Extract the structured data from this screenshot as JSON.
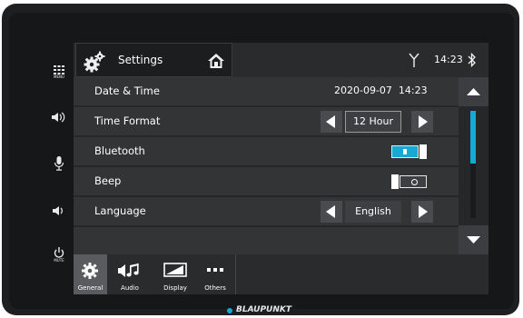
{
  "left_panel": {
    "menu_label": "MENU",
    "mute_label": "MUTE"
  },
  "header": {
    "title": "Settings",
    "clock": "14:23"
  },
  "settings_rows": [
    {
      "label": "Date & Time",
      "value": "2020-09-07  14:23"
    },
    {
      "label": "Time Format",
      "value": "12 Hour"
    },
    {
      "label": "Bluetooth",
      "state": "on"
    },
    {
      "label": "Beep",
      "state": "off"
    },
    {
      "label": "Language",
      "value": "English"
    }
  ],
  "scroll_position": 0,
  "tabs": [
    {
      "label": "General",
      "selected": true
    },
    {
      "label": "Audio"
    },
    {
      "label": "Display"
    },
    {
      "label": "Others"
    }
  ],
  "brand": "BLAUPUNKT",
  "colors": {
    "accent": "#17a8d6"
  },
  "icons": [
    "menu-grid-icon",
    "voice-call-icon",
    "microphone-icon",
    "volume-icon",
    "power-icon",
    "gear-icon",
    "home-icon",
    "antenna-icon",
    "bluetooth-icon",
    "arrow-up-icon",
    "arrow-down-icon",
    "arrow-left-icon",
    "arrow-right-icon",
    "music-icon",
    "display-icon",
    "more-icon"
  ]
}
